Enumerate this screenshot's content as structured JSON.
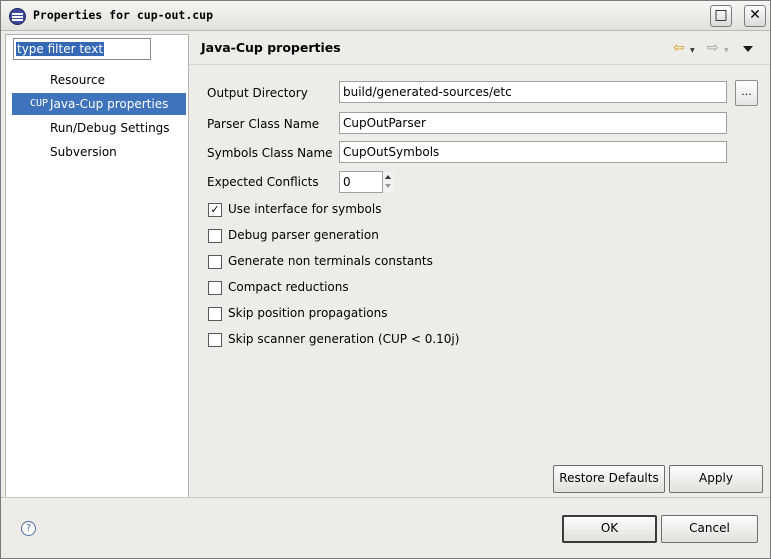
{
  "window": {
    "title": "Properties for cup-out.cup",
    "maximize_glyph": "□",
    "close_glyph": "✕"
  },
  "sidebar": {
    "filter_placeholder": "type filter text",
    "items": [
      {
        "label": "Resource",
        "icon": ""
      },
      {
        "label": "Java-Cup properties",
        "icon": "CUP"
      },
      {
        "label": "Run/Debug Settings",
        "icon": ""
      },
      {
        "label": "Subversion",
        "icon": ""
      }
    ],
    "selected_index": 1
  },
  "page": {
    "title": "Java-Cup properties",
    "back_glyph": "⇦",
    "forward_glyph": "⇨",
    "fields": {
      "output_directory": {
        "label": "Output Directory",
        "value": "build/generated-sources/etc"
      },
      "parser_class": {
        "label": "Parser Class Name",
        "value": "CupOutParser"
      },
      "symbols_class": {
        "label": "Symbols Class Name",
        "value": "CupOutSymbols"
      },
      "expected_conflicts": {
        "label": "Expected Conflicts",
        "value": "0"
      }
    },
    "browse_label": "...",
    "checkboxes": [
      {
        "label": "Use interface for symbols",
        "checked": true
      },
      {
        "label": "Debug parser generation",
        "checked": false
      },
      {
        "label": "Generate non terminals constants",
        "checked": false
      },
      {
        "label": "Compact reductions",
        "checked": false
      },
      {
        "label": "Skip position propagations",
        "checked": false
      },
      {
        "label": "Skip scanner generation (CUP < 0.10j)",
        "checked": false
      }
    ],
    "restore_defaults_label": "Restore Defaults",
    "apply_label": "Apply"
  },
  "footer": {
    "help_glyph": "?",
    "ok_label": "OK",
    "cancel_label": "Cancel"
  },
  "colors": {
    "selection": "#3f73bb",
    "filter_highlight": "#3468b4"
  }
}
